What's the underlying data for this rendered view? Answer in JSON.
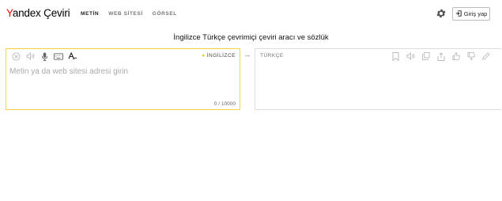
{
  "brand": {
    "logo_y": "Y",
    "logo_rest": "andex Çeviri"
  },
  "nav": {
    "items": [
      {
        "label": "METİN",
        "active": true
      },
      {
        "label": "WEB SİTESİ",
        "active": false
      },
      {
        "label": "GÖRSEL",
        "active": false
      }
    ]
  },
  "header": {
    "login_label": "Giriş yap",
    "settings_icon": "gear-icon",
    "login_icon": "sign-in-icon"
  },
  "subtitle": "İngilizce Türkçe çevrimiçi çeviri aracı ve sözlük",
  "source": {
    "language": "İNGİLİZCE",
    "placeholder": "Metin ya da web sitesi adresi girin",
    "value": "",
    "counter": "0 / 10000",
    "tools": [
      "clear-icon",
      "speaker-icon",
      "microphone-icon",
      "keyboard-icon",
      "spellcheck-icon"
    ]
  },
  "swap": {
    "icon": "swap-arrows-icon",
    "glyph": "↔"
  },
  "target": {
    "language": "TÜRKÇE",
    "tools": [
      "bookmark-icon",
      "speaker-icon",
      "copy-icon",
      "share-icon",
      "thumbs-up-icon",
      "thumbs-down-icon",
      "edit-icon"
    ]
  },
  "colors": {
    "accent": "#f3d64a",
    "brand_red": "#ff0000",
    "border": "#dddddd"
  }
}
